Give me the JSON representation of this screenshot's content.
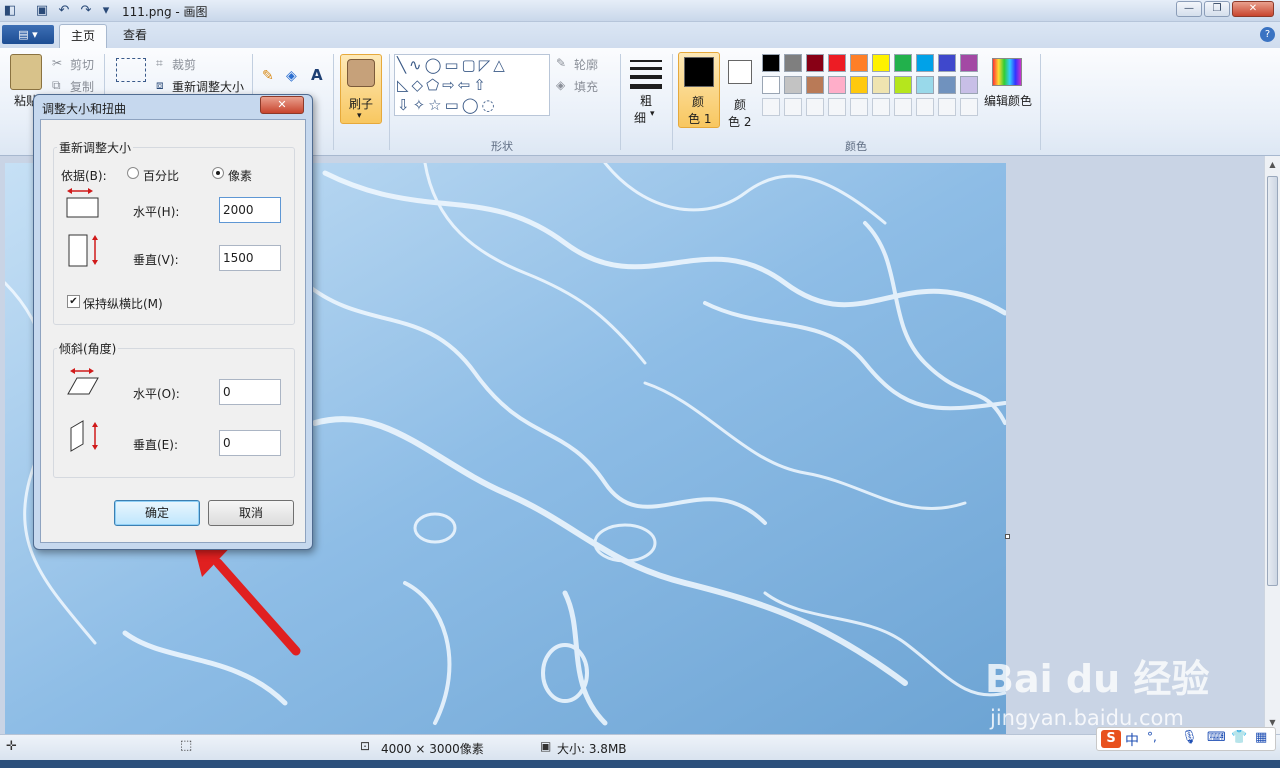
{
  "titlebar": {
    "title": "111.png - 画图"
  },
  "tabs": {
    "app_menu": "▤ ▾",
    "home": "主页",
    "view": "查看"
  },
  "clipboard": {
    "paste": "粘贴",
    "cut": "剪切",
    "copy": "复制"
  },
  "image": {
    "crop": "裁剪",
    "resize": "重新调整大小"
  },
  "brush": {
    "label": "刷子"
  },
  "shapes": {
    "outline": "轮廓",
    "fill": "填充",
    "group": "形状"
  },
  "size": {
    "label_1": "粗",
    "label_2": "细"
  },
  "colors": {
    "color1_a": "颜",
    "color1_b": "色 1",
    "color2_a": "颜",
    "color2_b": "色 2",
    "group": "颜色",
    "edit": "编辑颜色",
    "palette_row1": [
      "#000000",
      "#7f7f7f",
      "#880015",
      "#ed1c24",
      "#ff7f27",
      "#fff200",
      "#22b14c",
      "#00a2e8",
      "#3f48cc",
      "#a349a4"
    ],
    "palette_row2": [
      "#ffffff",
      "#c3c3c3",
      "#b97a57",
      "#ffaec9",
      "#ffc90e",
      "#efe4b0",
      "#b5e61d",
      "#99d9ea",
      "#7092be",
      "#c8bfe7"
    ],
    "primary": "#000000",
    "secondary": "#ffffff"
  },
  "dialog": {
    "title": "调整大小和扭曲",
    "resize_group": "重新调整大小",
    "by_label": "依据(B):",
    "percent_label": "百分比",
    "pixels_label": "像素",
    "horizontal_label": "水平(H):",
    "horizontal_value": "2000",
    "vertical_label": "垂直(V):",
    "vertical_value": "1500",
    "keep_ratio_label": "保持纵横比(M)",
    "skew_group": "倾斜(角度)",
    "skew_h_label": "水平(O):",
    "skew_h_value": "0",
    "skew_v_label": "垂直(E):",
    "skew_v_value": "0",
    "ok": "确定",
    "cancel": "取消",
    "close": "✕"
  },
  "statusbar": {
    "dimensions": "4000 × 3000像素",
    "size": "大小: 3.8MB"
  },
  "watermark": {
    "brand": "Bai du 经验",
    "url": "jingyan.baidu.com"
  },
  "ime": {
    "lang": "中"
  }
}
